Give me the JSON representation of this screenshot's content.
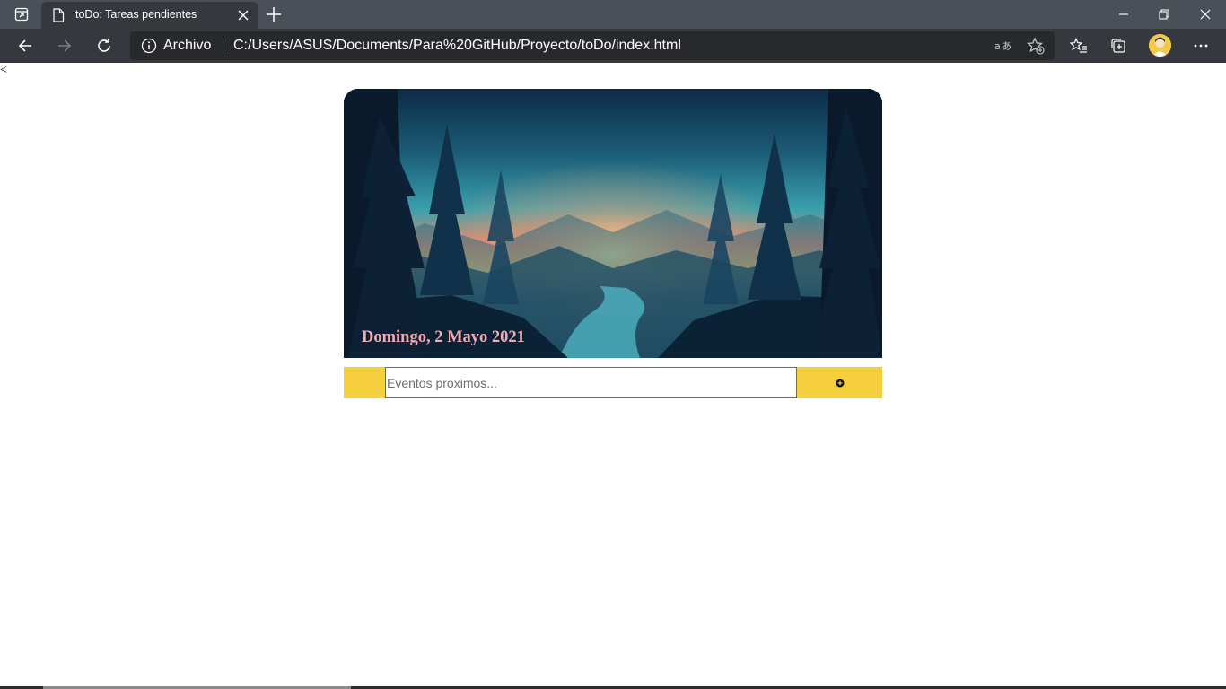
{
  "browser": {
    "tab": {
      "title": "toDo: Tareas pendientes",
      "favicon": "file-icon"
    },
    "toolbar": {
      "site_info_label": "Archivo",
      "url": "C:/Users/ASUS/Documents/Para%20GitHub/Proyecto/toDo/index.html"
    },
    "icons": [
      "tab-actions-icon",
      "close-icon",
      "plus-icon",
      "minimize-icon",
      "restore-icon",
      "close-window-icon",
      "back-arrow-icon",
      "forward-arrow-icon",
      "reload-icon",
      "info-icon",
      "read-aloud-icon",
      "favorite-add-icon",
      "favorites-icon",
      "collections-icon",
      "avatar",
      "more-icon"
    ]
  },
  "page": {
    "stray_text": "<",
    "hero": {
      "date": "Domingo, 2 Mayo 2021"
    },
    "entry": {
      "placeholder": "Eventos proximos...",
      "value": ""
    }
  },
  "colors": {
    "accent": "#f5cf3e",
    "date_text": "#f2aab0",
    "chrome_dark": "#35393e",
    "tabstrip": "#4a5057"
  }
}
